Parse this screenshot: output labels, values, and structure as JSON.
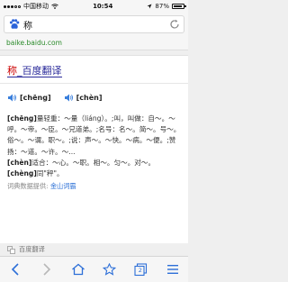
{
  "status_bar": {
    "carrier": "中国移动",
    "time": "10:54",
    "battery_percent_label": "87%",
    "battery_level": 0.87
  },
  "search": {
    "query": "称",
    "refresh_icon": "refresh-icon",
    "logo_icon": "paw-icon"
  },
  "url": "baike.baidu.com",
  "card": {
    "title_highlight": "称",
    "title_rest": "_百度翻译",
    "pronunciations": [
      "[chēng]",
      "[chèn]"
    ],
    "definitions": [
      {
        "head": "[chēng]",
        "text": "量轻重：～量（liáng）。;叫，叫做：自～。～呼。～帝。～臣。～兄道弟。;名号：名～。简～。号～。俗～。～谓。职～。;说：声～。～快。～病。～便。;赞扬：～道。～许。～..."
      },
      {
        "head": "[chèn]",
        "text": "适合：～心。～职。相～。匀～。对～。"
      },
      {
        "head": "[chèng]",
        "text": "同\"秤\"。"
      }
    ],
    "source_label": "词典数据提供:",
    "source_link": "金山词霸"
  },
  "footer": {
    "label": "百度翻译"
  },
  "toolbar": {
    "back_icon": "back-icon",
    "forward_icon": "forward-icon",
    "home_icon": "home-icon",
    "bookmark_icon": "star-icon",
    "tabs_icon": "tabs-icon",
    "tabs_count": "2",
    "menu_icon": "menu-icon"
  },
  "colors": {
    "link_green": "#2a8a2a",
    "title_blue": "#2a2a9a",
    "title_highlight_red": "#cc0000",
    "speaker_blue": "#3a7fdc"
  }
}
